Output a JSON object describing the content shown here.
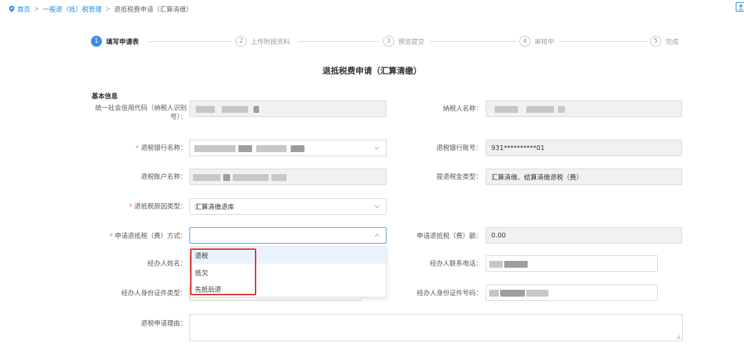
{
  "breadcrumb": {
    "home": "首页",
    "level2": "一般退（抵）税管理",
    "current": "退抵税费申请（汇算清缴）",
    "separator": ">"
  },
  "steps": [
    {
      "num": "1",
      "label": "填写申请表",
      "active": true
    },
    {
      "num": "2",
      "label": "上传附报资料",
      "active": false
    },
    {
      "num": "3",
      "label": "预览提交",
      "active": false
    },
    {
      "num": "4",
      "label": "审核中",
      "active": false
    },
    {
      "num": "5",
      "label": "完成",
      "active": false
    }
  ],
  "form": {
    "title": "退抵税费申请（汇算清缴）",
    "section": "基本信息",
    "credit_code_label_line1": "统一社会信用代码（纳税人识别",
    "credit_code_label_line2": "号）：",
    "taxpayer_name_label": "纳税人名称：",
    "bank_name_label": "退税银行名称：",
    "bank_account_label": "退税银行账号：",
    "bank_account_value": "931**********01",
    "account_name_label": "退税账户名称：",
    "refund_type_label": "提退税金类型：",
    "refund_type_value": "汇算清缴、结算清缴退税（费）",
    "reason_label": "退抵税原因类型：",
    "reason_value": "汇算清缴退库",
    "method_label": "申请退抵税（费）方式：",
    "amount_label": "申请退抵税（费）额：",
    "amount_value": "0.00",
    "handler_name_label": "经办人姓名：",
    "handler_phone_label": "经办人联系电话：",
    "id_type_label": "经办人身份证件类型：",
    "id_number_label": "经办人身份证件号码：",
    "reason_text_label": "退税申请理由：",
    "required_mark": "*"
  },
  "dropdown": {
    "options": [
      "退税",
      "抵欠",
      "先抵后退"
    ],
    "hovered_index": 0
  },
  "colors": {
    "accent": "#3a8ee6",
    "link": "#1e88e5",
    "required": "#f56c6c",
    "highlight": "#e0302b"
  }
}
